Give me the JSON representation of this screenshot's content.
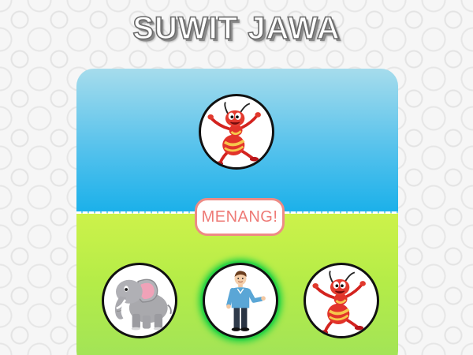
{
  "game": {
    "title": "SUWIT JAWA",
    "result_label": "MENANG!"
  },
  "opponent": {
    "choice": "ant",
    "icon": "ant-icon"
  },
  "player": {
    "choices": [
      {
        "id": "elephant",
        "icon": "elephant-icon",
        "selected": false
      },
      {
        "id": "human",
        "icon": "human-icon",
        "selected": true
      },
      {
        "id": "ant",
        "icon": "ant-icon",
        "selected": false
      }
    ]
  },
  "colors": {
    "sky_top": "#a6dcec",
    "sky_bottom": "#1ab0ea",
    "grass_top": "#cdf24a",
    "grass_bottom": "#9fe25a",
    "result_accent": "#ee8b85",
    "selected_glow": "#28d445"
  }
}
